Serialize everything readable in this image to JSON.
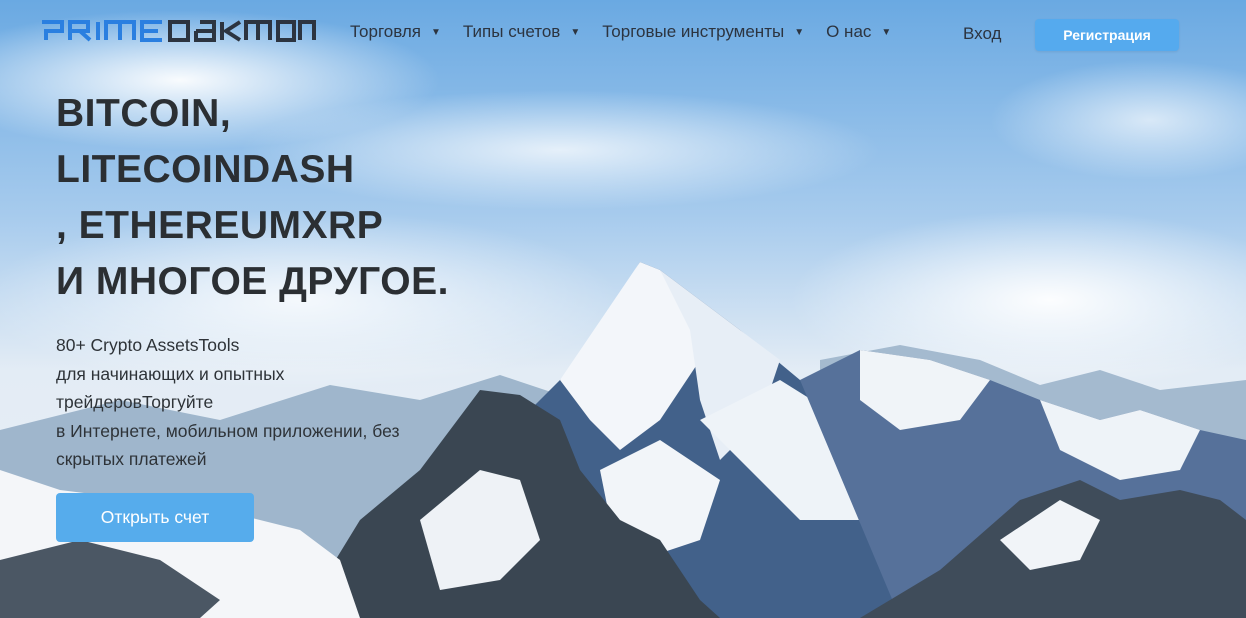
{
  "brand": {
    "logo_text": "PRIMEOAKMONT",
    "logo_part1": "PRIME",
    "logo_part2": "OAKMONT",
    "accent_color": "#2a7fe0",
    "dark_color": "#2c3440"
  },
  "nav": {
    "items": [
      {
        "label": "Торговля",
        "icon": "caret-down-icon"
      },
      {
        "label": "Типы счетов",
        "icon": "caret-down-icon"
      },
      {
        "label": "Торговые инструменты",
        "icon": "caret-down-icon"
      },
      {
        "label": "О нас",
        "icon": "caret-down-icon"
      }
    ],
    "login_label": "Вход",
    "signup_label": "Регистрация",
    "signup_color": "#55aaee"
  },
  "hero": {
    "title_lines": [
      "BITCOIN,",
      "LITECOINDASH",
      ", ETHEREUMXRP",
      "И МНОГОЕ ДРУГОЕ."
    ],
    "subtitle_lines": [
      "80+ Crypto AssetsTools",
      "для начинающих и опытных",
      "трейдеровТоргуйте",
      "в Интернете, мобильном приложении, без",
      "скрытых платежей"
    ],
    "cta_label": "Открыть счет",
    "cta_color": "#56acec"
  }
}
